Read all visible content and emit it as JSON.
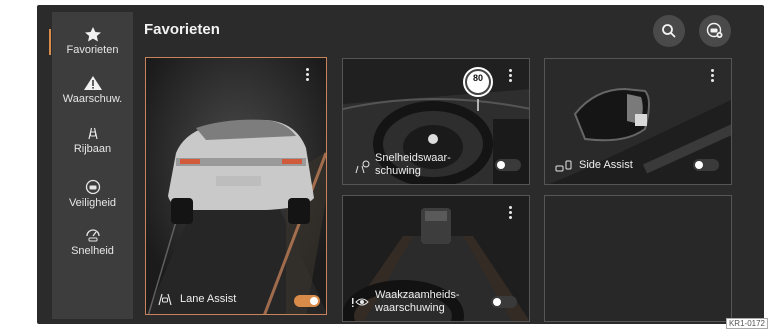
{
  "sidebar": {
    "items": [
      {
        "label": "Favorieten",
        "icon": "star-icon"
      },
      {
        "label": "Waarschuw.",
        "icon": "warning-icon"
      },
      {
        "label": "Rijbaan",
        "icon": "lane-icon"
      },
      {
        "label": "Veiligheid",
        "icon": "shield-car-icon"
      },
      {
        "label": "Snelheid",
        "icon": "speed-icon"
      }
    ]
  },
  "header": {
    "title": "Favorieten"
  },
  "cards": {
    "lane_assist": {
      "label": "Lane Assist",
      "toggle_on": true
    },
    "speed_warning": {
      "label_line1": "Snelheidswaar-",
      "label_line2": "schuwing",
      "toggle_on": false,
      "speed_sign": "80"
    },
    "side_assist": {
      "label": "Side Assist",
      "toggle_on": false
    },
    "attention_warning": {
      "label_line1": "Waakzaamheids-",
      "label_line2": "waarschuwing",
      "toggle_on": false
    }
  },
  "image_tag": "KR1-0172",
  "colors": {
    "accent": "#d98b4a",
    "toggle_on": "#d98b4a",
    "toggle_off": "#5a5a5a"
  }
}
